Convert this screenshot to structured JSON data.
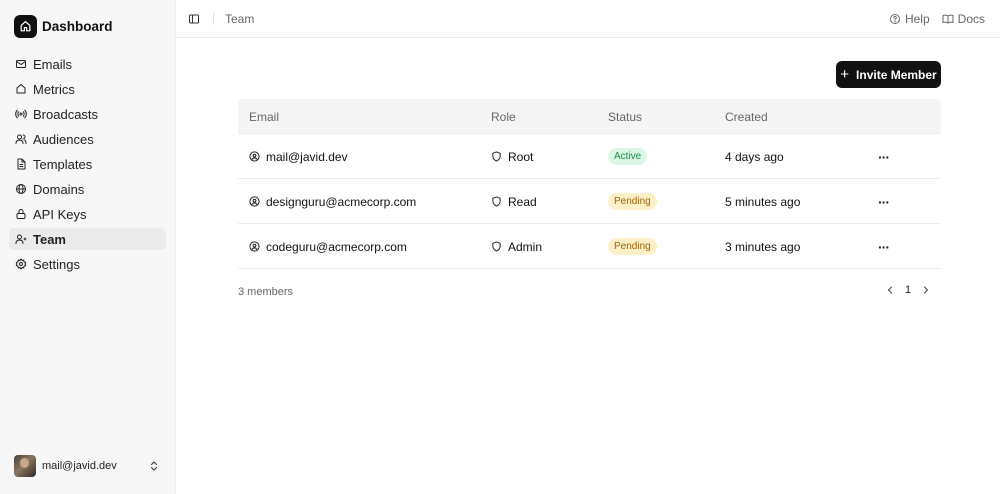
{
  "sidebar": {
    "brand": "Dashboard",
    "items": [
      {
        "label": "Emails",
        "icon": "mail-icon"
      },
      {
        "label": "Metrics",
        "icon": "home-icon"
      },
      {
        "label": "Broadcasts",
        "icon": "broadcast-icon"
      },
      {
        "label": "Audiences",
        "icon": "users-icon"
      },
      {
        "label": "Templates",
        "icon": "document-icon"
      },
      {
        "label": "Domains",
        "icon": "globe-icon"
      },
      {
        "label": "API Keys",
        "icon": "lock-icon"
      },
      {
        "label": "Team",
        "icon": "team-icon",
        "active": true
      },
      {
        "label": "Settings",
        "icon": "gear-icon"
      }
    ],
    "user_email": "mail@javid.dev"
  },
  "topbar": {
    "breadcrumb": "Team",
    "help": "Help",
    "docs": "Docs"
  },
  "main": {
    "invite_button": "Invite Member",
    "table": {
      "headers": [
        "Email",
        "Role",
        "Status",
        "Created"
      ],
      "rows": [
        {
          "email": "mail@javid.dev",
          "role": "Root",
          "status": "Active",
          "created": "4 days ago"
        },
        {
          "email": "designguru@acmecorp.com",
          "role": "Read",
          "status": "Pending",
          "created": "5 minutes ago"
        },
        {
          "email": "codeguru@acmecorp.com",
          "role": "Admin",
          "status": "Pending",
          "created": "3 minutes ago"
        }
      ]
    },
    "member_count": "3 members",
    "page_number": "1"
  },
  "colors": {
    "primary_button": "#111111",
    "active_badge_bg": "#dcf6e6",
    "active_badge_text": "#1f8a4c",
    "pending_badge_bg": "#fdf0c8",
    "pending_badge_text": "#a0620b"
  }
}
